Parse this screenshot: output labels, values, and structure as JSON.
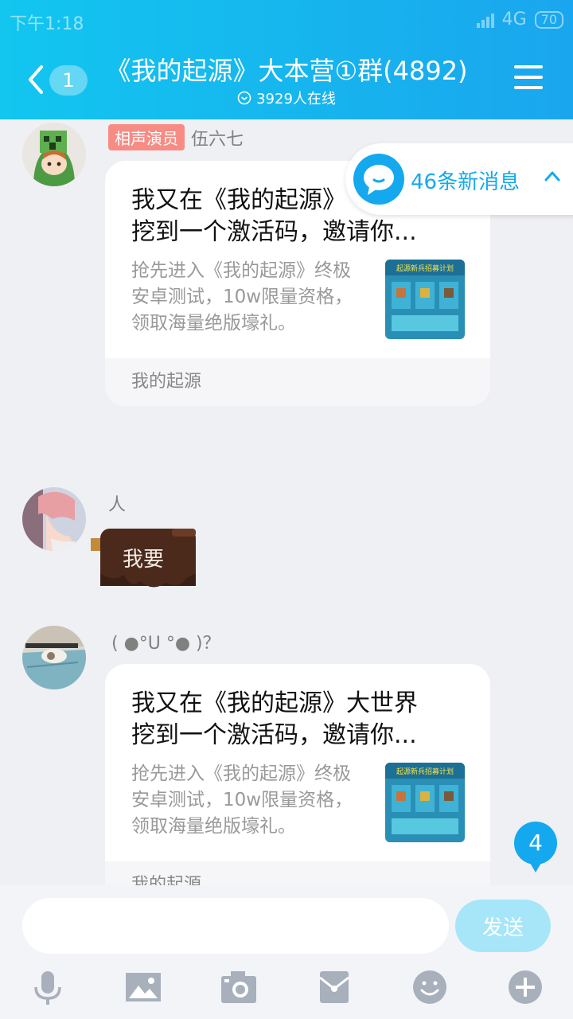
{
  "status_bar": {
    "time": "下午1:18",
    "network": "4G",
    "battery": "70"
  },
  "header": {
    "back_count": "1",
    "title": "《我的起源》大本营①群(4892)",
    "online": "3929人在线"
  },
  "new_messages_toast": "46条新消息",
  "messages": [
    {
      "sender": "伍六七",
      "tag": "相声演员",
      "card": {
        "title": "我又在《我的起源》大世界挖到一个激活码，邀请你...",
        "title_line1": "我又在《我的起源》",
        "title_line2": "挖到一个激活码，邀请你...",
        "desc_line1": "抢先进入《我的起源》终极",
        "desc_line2": "安卓测试，10w限量资格，",
        "desc_line3": "领取海量绝版壕礼。",
        "thumb_caption": "起源新兵招募计划",
        "source": "我的起源"
      }
    },
    {
      "sender": "人",
      "sticker_text": "我要"
    },
    {
      "sender": "( ●°U °● )？",
      "card": {
        "title_line1": "我又在《我的起源》大世界",
        "title_line2": "挖到一个激活码，邀请你...",
        "desc_line1": "抢先进入《我的起源》终极",
        "desc_line2": "安卓测试，10w限量资格，",
        "desc_line3": "领取海量绝版壕礼。",
        "thumb_caption": "起源新兵招募计划",
        "source": "我的起源"
      }
    }
  ],
  "unread_badge": "4",
  "input": {
    "value": "",
    "send_label": "发送"
  },
  "toolbar_icons": [
    "microphone-icon",
    "image-icon",
    "camera-icon",
    "red-packet-icon",
    "emoji-icon",
    "plus-icon"
  ],
  "colors": {
    "accent": "#14a9ee",
    "header_start": "#12c6ef",
    "tag": "#f78c84",
    "send_disabled": "#a6e6f8"
  }
}
